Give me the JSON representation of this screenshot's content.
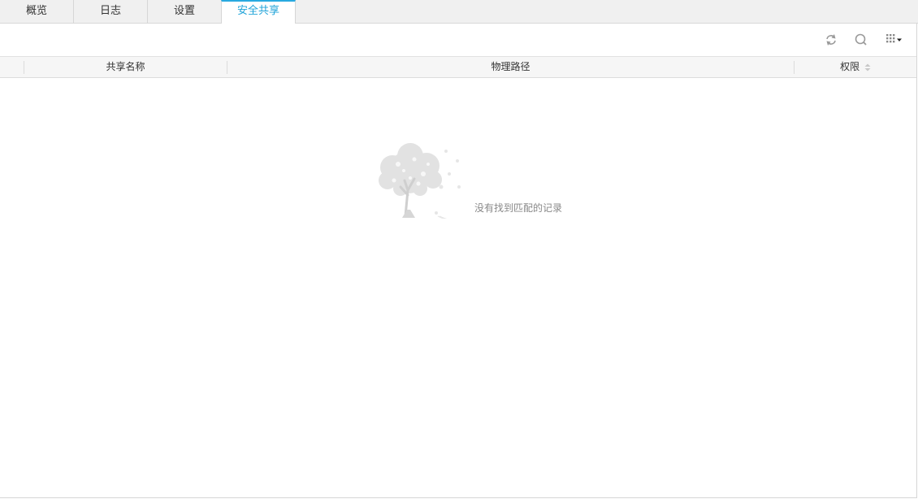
{
  "tabs": [
    {
      "label": "概览",
      "active": false
    },
    {
      "label": "日志",
      "active": false
    },
    {
      "label": "设置",
      "active": false
    },
    {
      "label": "安全共享",
      "active": true
    }
  ],
  "toolbar": {
    "refresh_icon": "refresh-icon",
    "search_icon": "search-icon",
    "columns_icon": "grid-columns-icon"
  },
  "table": {
    "columns": [
      "共享名称",
      "物理路径",
      "权限"
    ],
    "sortable_column": "权限",
    "rows": []
  },
  "empty_state": {
    "message": "没有找到匹配的记录",
    "illustration": "tree-icon"
  },
  "colors": {
    "accent": "#29a9e0",
    "tab_active_text": "#1fa3d8"
  }
}
